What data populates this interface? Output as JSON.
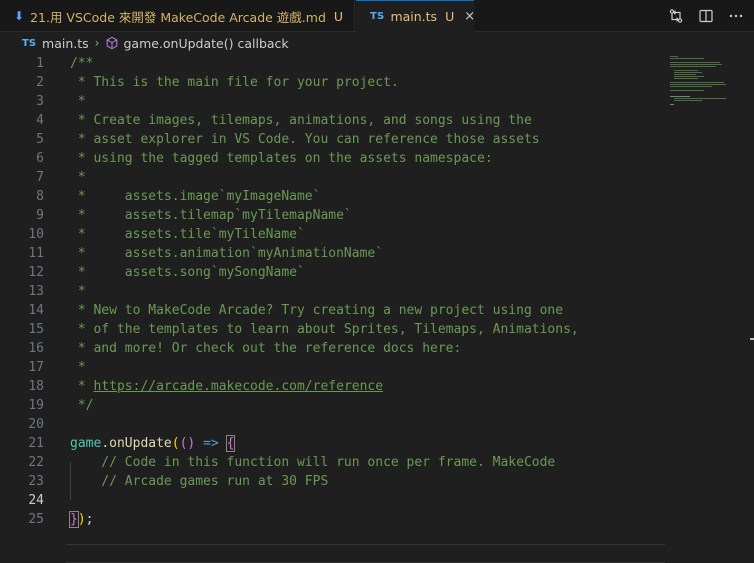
{
  "tabs": [
    {
      "title": "21.用 VSCode 來開發 MakeCode Arcade 遊戲.md",
      "badge": "U",
      "icon": "download-arrow-icon",
      "active": false
    },
    {
      "icon_label": "TS",
      "title": "main.ts",
      "badge": "U",
      "close": "×",
      "active": true
    }
  ],
  "toolbar": {
    "actions": [
      "compare-changes-icon",
      "split-editor-icon",
      "more-actions-icon"
    ]
  },
  "breadcrumb": {
    "file_icon": "TS",
    "file": "main.ts",
    "symbol": "game.onUpdate() callback"
  },
  "editor": {
    "current_line": 24,
    "lines": [
      {
        "n": "1",
        "text": "/**"
      },
      {
        "n": "2",
        "text": " * This is the main file for your project."
      },
      {
        "n": "3",
        "text": " *"
      },
      {
        "n": "4",
        "text": " * Create images, tilemaps, animations, and songs using the"
      },
      {
        "n": "5",
        "text": " * asset explorer in VS Code. You can reference those assets"
      },
      {
        "n": "6",
        "text": " * using the tagged templates on the assets namespace:"
      },
      {
        "n": "7",
        "text": " *"
      },
      {
        "n": "8",
        "text": " *     assets.image`myImageName`"
      },
      {
        "n": "9",
        "text": " *     assets.tilemap`myTilemapName`"
      },
      {
        "n": "10",
        "text": " *     assets.tile`myTileName`"
      },
      {
        "n": "11",
        "text": " *     assets.animation`myAnimationName`"
      },
      {
        "n": "12",
        "text": " *     assets.song`mySongName`"
      },
      {
        "n": "13",
        "text": " *"
      },
      {
        "n": "14",
        "text": " * New to MakeCode Arcade? Try creating a new project using one"
      },
      {
        "n": "15",
        "text": " * of the templates to learn about Sprites, Tilemaps, Animations,"
      },
      {
        "n": "16",
        "text": " * and more! Or check out the reference docs here:"
      },
      {
        "n": "17",
        "text": " *"
      },
      {
        "n": "18",
        "text": " * ",
        "link": "https://arcade.makecode.com/reference"
      },
      {
        "n": "19",
        "text": " */"
      },
      {
        "n": "20",
        "text": ""
      },
      {
        "n": "21",
        "tokens": {
          "obj": "game",
          "dot": ".",
          "fn": "onUpdate",
          "p1": "(",
          "p2": "()",
          "arrow": " => ",
          "brace": "{"
        }
      },
      {
        "n": "22",
        "text": "    // Code in this function will run once per frame. MakeCode"
      },
      {
        "n": "23",
        "text": "    // Arcade games run at 30 FPS"
      },
      {
        "n": "24",
        "text": ""
      },
      {
        "n": "25",
        "tokens": {
          "close_brace": "}",
          "close_paren": ")",
          "semi": ";"
        }
      }
    ]
  },
  "colors": {
    "background": "#1f1f1f",
    "comment": "#6a9955",
    "active_tab_border": "#0078d4",
    "modified": "#e5c07b"
  }
}
